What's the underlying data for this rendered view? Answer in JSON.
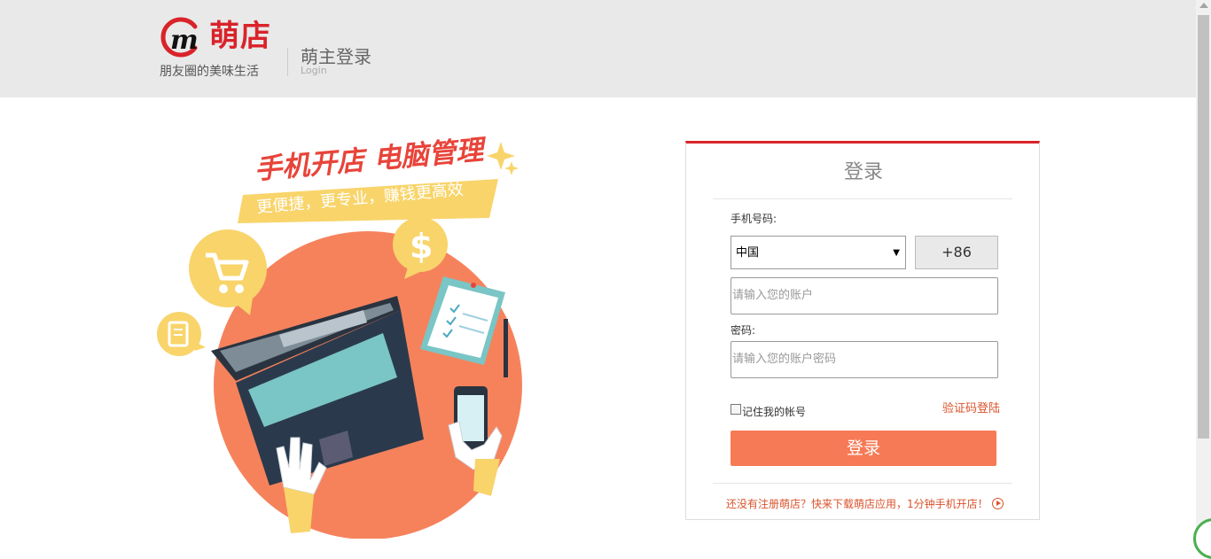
{
  "header": {
    "brand_name": "萌店",
    "slogan": "朋友圈的美味生活",
    "login_title": "萌主登录",
    "login_sub": "Login"
  },
  "promo": {
    "headline": "手机开店 电脑管理",
    "tagline": "更便捷，更专业，赚钱更高效"
  },
  "login_form": {
    "title": "登录",
    "phone_label": "手机号码:",
    "country_select": "中国",
    "country_code": "+86",
    "account_placeholder": "请输入您的账户",
    "password_label": "密码:",
    "password_placeholder": "请输入您的账户密码",
    "remember_label": "记住我的帐号",
    "sms_login_link": "验证码登陆",
    "submit_label": "登录",
    "register_text": "还没有注册萌店？快来下载萌店应用，1分钟手机开店！"
  },
  "colors": {
    "brand_red": "#d9232a",
    "button_orange": "#f67a55",
    "link_orange": "#d9532b",
    "illustration_circle": "#f6825c",
    "accent_yellow": "#f8d46a"
  }
}
